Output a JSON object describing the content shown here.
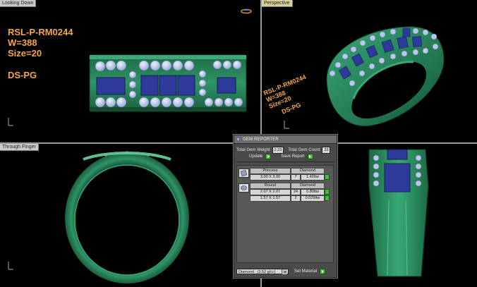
{
  "viewports": {
    "top_left_label": "Looking Down",
    "top_right_label": "Perspective",
    "bottom_left_label": "Through Finger"
  },
  "spec": {
    "code": "RSL-P-RM0244",
    "weight": "W=388",
    "size": "Size=20",
    "metal": "DS-PG"
  },
  "colors": {
    "metal_green": "#2f9467",
    "metal_dark": "#12522f",
    "stone_blue": "#2d3a9a",
    "diamond": "#b9c8e8",
    "spec_orange": "#f3a64a"
  },
  "gem_reporter": {
    "title": "GEM REPORTER",
    "total_gem_weight_label": "Total Gem Weight",
    "total_gem_weight_value": "2.23",
    "total_gem_count_label": "Total Gem Count",
    "total_gem_count_value": "33",
    "update_label": "Update",
    "save_report_label": "Save Report",
    "groups": [
      {
        "shape": "Princess",
        "material": "Diamond",
        "rows": [
          {
            "size": "3.00 X 3.00",
            "count": "7",
            "weight": "1.42ttw"
          }
        ]
      },
      {
        "shape": "Round",
        "material": "Diamond",
        "rows": [
          {
            "size": "2.07 X 2.07",
            "count": "24",
            "weight": "0.80ttw"
          },
          {
            "size": "1.57 X 1.57",
            "count": "2",
            "weight": "0.029ttw"
          }
        ]
      }
    ],
    "material_select": "Diamond",
    "material_select_density": "(3.52 g/cc)",
    "set_material_label": "Set Material"
  }
}
